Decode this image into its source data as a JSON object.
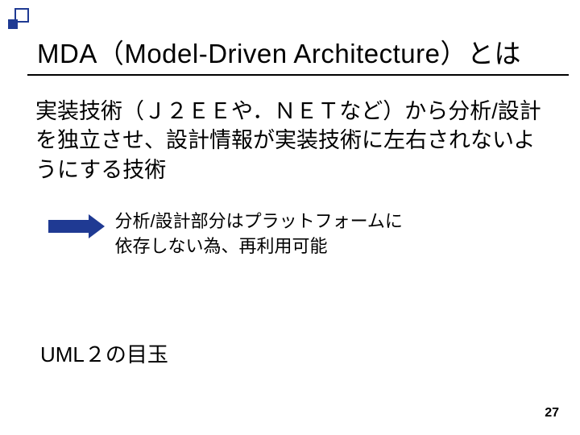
{
  "slide": {
    "title": "MDA（Model-Driven Architecture）とは",
    "body": "実装技術（Ｊ２ＥＥや．ＮＥＴなど）から分析/設計を独立させ、設計情報が実装技術に左右されないようにする技術",
    "arrow_text_line1": "分析/設計部分はプラットフォームに",
    "arrow_text_line2": "依存しない為、再利用可能",
    "footer": "UML２の目玉",
    "page_number": "27"
  }
}
